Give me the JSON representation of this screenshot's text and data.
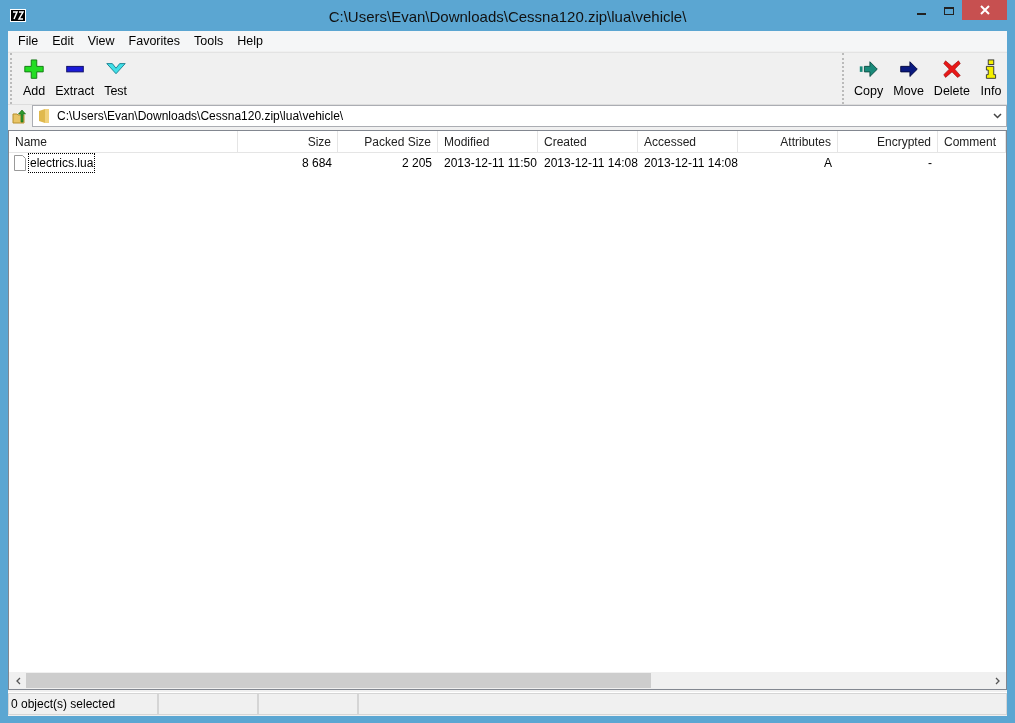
{
  "window": {
    "title": "C:\\Users\\Evan\\Downloads\\Cessna120.zip\\lua\\vehicle\\"
  },
  "menu": [
    "File",
    "Edit",
    "View",
    "Favorites",
    "Tools",
    "Help"
  ],
  "toolbar_left": [
    {
      "kind": "add",
      "label": "Add"
    },
    {
      "kind": "extract",
      "label": "Extract"
    },
    {
      "kind": "test",
      "label": "Test"
    }
  ],
  "toolbar_right": [
    {
      "kind": "copy",
      "label": "Copy"
    },
    {
      "kind": "move",
      "label": "Move"
    },
    {
      "kind": "delete",
      "label": "Delete"
    },
    {
      "kind": "info",
      "label": "Info"
    }
  ],
  "address": {
    "value": "C:\\Users\\Evan\\Downloads\\Cessna120.zip\\lua\\vehicle\\"
  },
  "table": {
    "columns": [
      "Name",
      "Size",
      "Packed Size",
      "Modified",
      "Created",
      "Accessed",
      "Attributes",
      "Encrypted",
      "Comment"
    ],
    "rows": [
      {
        "focused": true,
        "cells": [
          "electrics.lua",
          "8 684",
          "2 205",
          "2013-12-11 11:50",
          "2013-12-11 14:08",
          "2013-12-11 14:08",
          "A",
          "-"
        ]
      }
    ]
  },
  "status_bar": [
    "0 object(s) selected"
  ]
}
